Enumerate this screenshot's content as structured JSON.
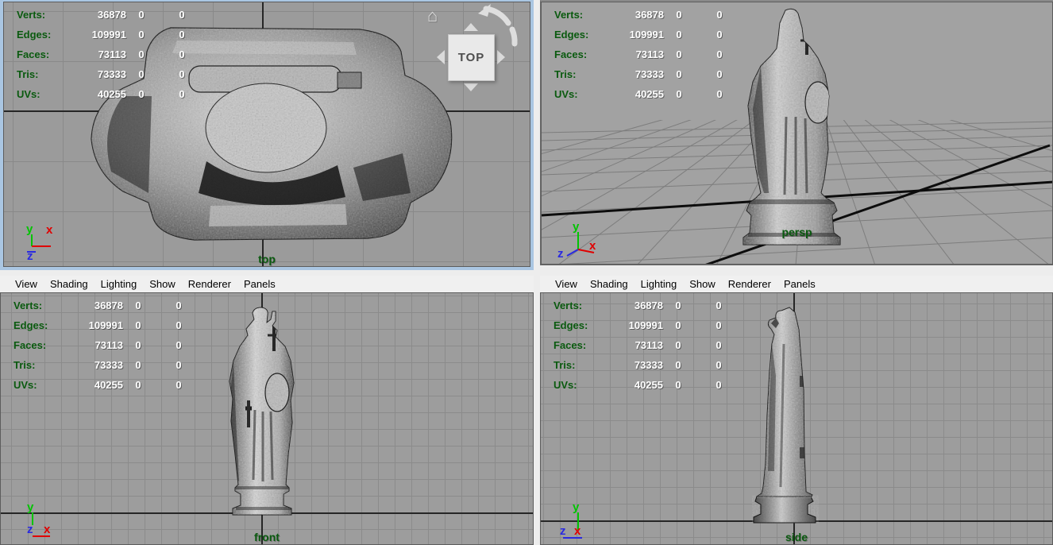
{
  "app": {
    "description": "quad-view 3D viewport of a stone statue model"
  },
  "colors": {
    "hud_label": "#0a5a0f",
    "hud_value": "#ffffff",
    "viewport_label": "#0a5a0f",
    "active_viewport_border": "#aac6e2",
    "menu_bg": "#f0f0f0",
    "ortho_bg": "#9b9b9b",
    "persp_bg": "#a2a2a2",
    "grid_line": "#898989",
    "axis_line": "#262626",
    "axis_x": "#e00000",
    "axis_y": "#00c400",
    "axis_z": "#2a2ae0"
  },
  "stats": {
    "rows": [
      {
        "label": "Verts:",
        "total": "36878",
        "col2": "0",
        "col3": "0"
      },
      {
        "label": "Edges:",
        "total": "109991",
        "col2": "0",
        "col3": "0"
      },
      {
        "label": "Faces:",
        "total": "73113",
        "col2": "0",
        "col3": "0"
      },
      {
        "label": "Tris:",
        "total": "73333",
        "col2": "0",
        "col3": "0"
      },
      {
        "label": "UVs:",
        "total": "40255",
        "col2": "0",
        "col3": "0"
      }
    ]
  },
  "menu": {
    "items": [
      "View",
      "Shading",
      "Lighting",
      "Show",
      "Renderer",
      "Panels"
    ]
  },
  "viewports": {
    "top": {
      "label": "top"
    },
    "persp": {
      "label": "persp"
    },
    "front": {
      "label": "front"
    },
    "side": {
      "label": "side"
    }
  },
  "viewcube": {
    "label": "TOP",
    "home_icon": "⌂"
  },
  "axes": {
    "x": "x",
    "y": "y",
    "z": "z"
  }
}
